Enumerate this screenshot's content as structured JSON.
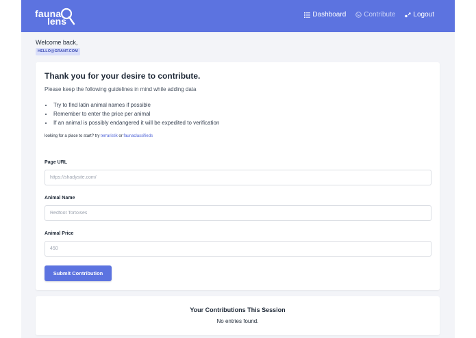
{
  "brand": {
    "line1": "fauna",
    "line2": "lens",
    "color": "#5c73e0"
  },
  "nav": {
    "items": [
      {
        "label": "Dashboard",
        "icon": "list-icon",
        "active": false
      },
      {
        "label": "Contribute",
        "icon": "globe-icon",
        "active": true
      },
      {
        "label": "Logout",
        "icon": "logout-icon",
        "active": false
      }
    ]
  },
  "user": {
    "welcome": "Welcome back,",
    "email": "HELLO@GRANT.COM"
  },
  "form": {
    "heading": "Thank you for your desire to contribute.",
    "subheading": "Please keep the following guidelines in mind while adding data",
    "guidelines": [
      "Try to find latin animal names if possible",
      "Remember to enter the price per animal",
      "If an animal is possibly endangered it will be expedited to verification"
    ],
    "hint_prefix": "looking for a place to start? try",
    "hint_link1": "terraristik",
    "hint_or": "or",
    "hint_link2": "faunaclassifieds",
    "fields": [
      {
        "label": "Page URL",
        "placeholder": "https://shadysite.com/"
      },
      {
        "label": "Animal Name",
        "placeholder": "Redfoot Tortoises"
      },
      {
        "label": "Animal Price",
        "placeholder": "450"
      }
    ],
    "submit_label": "Submit Contribution"
  },
  "session": {
    "title": "Your Contributions This Session",
    "empty": "No entries found."
  }
}
